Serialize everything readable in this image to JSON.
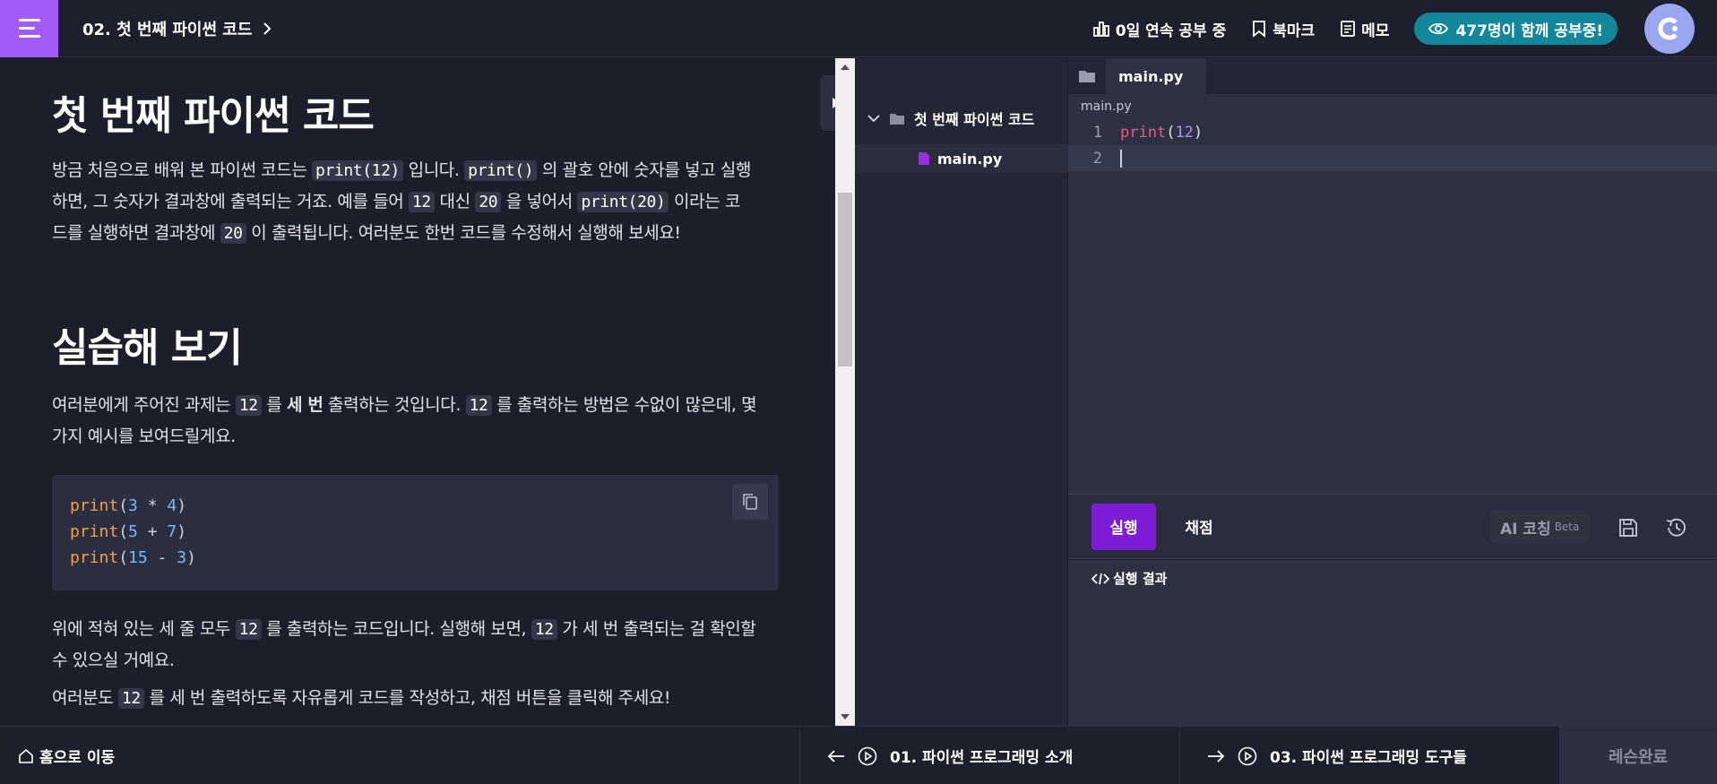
{
  "header": {
    "breadcrumb": "02. 첫 번째 파이썬 코드",
    "streak": "0일 연속 공부 중",
    "bookmark": "북마크",
    "memo": "메모",
    "live_count": "477명이 함께 공부중!"
  },
  "lesson": {
    "title1": "첫 번째 파이썬 코드",
    "p1": [
      "방금 처음으로 배워 본 파이썬 코드는 ",
      "print(12)",
      " 입니다. ",
      "print()",
      " 의 괄호 안에 숫자를 넣고 실행",
      "하면, 그 숫자가 결과창에 출력되는 거죠. 예를 들어 ",
      "12",
      " 대신 ",
      "20",
      " 을 넣어서 ",
      "print(20)",
      " 이라는 코",
      "드를 실행하면 결과창에 ",
      "20",
      " 이 출력됩니다. 여러분도 한번 코드를 수정해서 실행해 보세요!"
    ],
    "title2": "실습해 보기",
    "p2": [
      "여러분에게 주어진 과제는 ",
      "12",
      " 를 ",
      "세 번",
      " 출력하는 것입니다. ",
      "12",
      " 를 출력하는 방법은 수없이 많은데, 몇",
      "가지 예시를 보여드릴게요."
    ],
    "code": [
      {
        "fn": "print",
        "a": "3",
        "op": " * ",
        "b": "4"
      },
      {
        "fn": "print",
        "a": "5",
        "op": " + ",
        "b": "7"
      },
      {
        "fn": "print",
        "a": "15",
        "op": " - ",
        "b": "3"
      }
    ],
    "p3": [
      "위에 적혀 있는 세 줄 모두 ",
      "12",
      " 를 출력하는 코드입니다. 실행해 보면, ",
      "12",
      " 가 세 번 출력되는 걸 확인할",
      "수 있으실 거예요."
    ],
    "p4": [
      "여러분도 ",
      "12",
      " 를 세 번 출력하도록 자유롭게 코드를 작성하고, 채점 버튼을 클릭해 주세요!"
    ]
  },
  "filetree": {
    "folder": "첫 번째 파이썬 코드",
    "file": "main.py"
  },
  "editor": {
    "tab": "main.py",
    "path": "main.py",
    "lines": [
      {
        "no": "1",
        "fn": "print",
        "open": "(",
        "arg": "12",
        "close": ")"
      },
      {
        "no": "2"
      }
    ]
  },
  "runbar": {
    "run": "실행",
    "grade": "채점",
    "ai": "AI 코칭",
    "beta": "Beta"
  },
  "output": {
    "title": "실행 결과"
  },
  "footer": {
    "home": "홈으로 이동",
    "prev": "01. 파이썬 프로그래밍 소개",
    "next": "03. 파이썬 프로그래밍 도구들",
    "done": "레슨완료"
  },
  "colors": {
    "accent": "#a25bf7",
    "run": "#7d1ed6",
    "live": "#13879a"
  }
}
